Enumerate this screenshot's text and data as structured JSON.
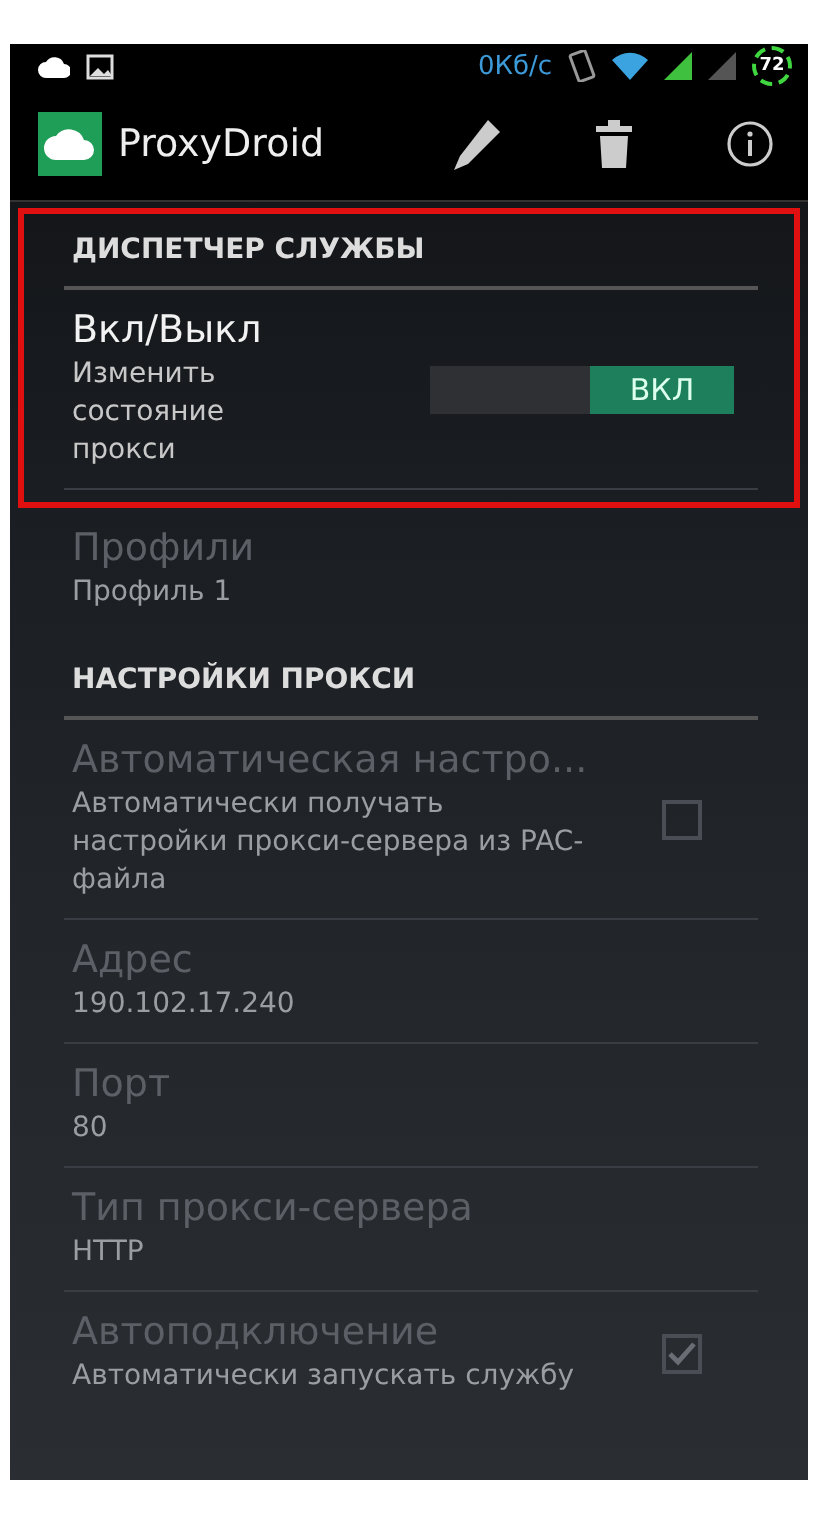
{
  "status_bar": {
    "network_speed": "0Кб/с",
    "battery": "72"
  },
  "app_bar": {
    "title": "ProxyDroid"
  },
  "sections": [
    {
      "header": "ДИСПЕТЧЕР СЛУЖБЫ",
      "highlighted": true,
      "items": [
        {
          "kind": "switch",
          "title": "Вкл/Выкл",
          "summary": "Изменить состояние прокси",
          "on": true,
          "switch_label": "ВКЛ",
          "disabled": false
        },
        {
          "kind": "text",
          "title": "Профили",
          "summary": "Профиль 1",
          "disabled": true
        }
      ]
    },
    {
      "header": "НАСТРОЙКИ ПРОКСИ",
      "highlighted": false,
      "items": [
        {
          "kind": "checkbox",
          "title": "Автоматическая настро...",
          "summary": "Автоматически получать настройки прокси-сервера из PAC-файла",
          "checked": false,
          "disabled": true
        },
        {
          "kind": "text",
          "title": "Адрес",
          "summary": "190.102.17.240",
          "disabled": true
        },
        {
          "kind": "text",
          "title": "Порт",
          "summary": "80",
          "disabled": true
        },
        {
          "kind": "text",
          "title": "Тип прокси-сервера",
          "summary": "HTTP",
          "disabled": true
        },
        {
          "kind": "checkbox",
          "title": "Автоподключение",
          "summary": "Автоматически запускать службу",
          "checked": true,
          "disabled": true
        }
      ]
    }
  ]
}
